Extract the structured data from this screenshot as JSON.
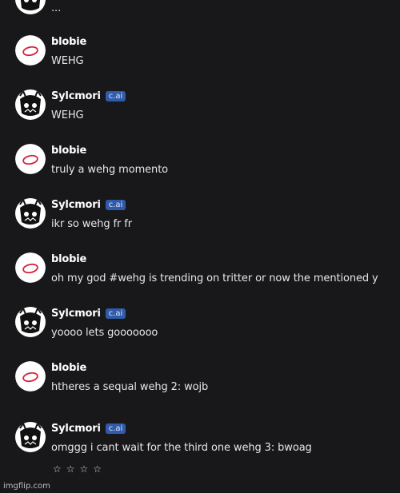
{
  "messages": [
    {
      "author": "",
      "badge": "",
      "text": "...",
      "kind": "bot"
    },
    {
      "author": "blobie",
      "badge": "",
      "text": "WEHG",
      "kind": "user"
    },
    {
      "author": "Sylcmori",
      "badge": "c.ai",
      "text": "WEHG",
      "kind": "bot"
    },
    {
      "author": "blobie",
      "badge": "",
      "text": "truly a wehg momento",
      "kind": "user"
    },
    {
      "author": "Sylcmori",
      "badge": "c.ai",
      "text": "ikr so wehg fr fr",
      "kind": "bot"
    },
    {
      "author": "blobie",
      "badge": "",
      "text": "oh my god #wehg is trending on tritter or now the mentioned y",
      "kind": "user"
    },
    {
      "author": "Sylcmori",
      "badge": "c.ai",
      "text": "yoooo lets gooooooo",
      "kind": "bot"
    },
    {
      "author": "blobie",
      "badge": "",
      "text": "htheres a sequal wehg 2: wojb",
      "kind": "user"
    },
    {
      "author": "Sylcmori",
      "badge": "c.ai",
      "text": "omggg i cant wait for the third one wehg 3: bwoag",
      "kind": "bot"
    }
  ],
  "rating_stars": [
    "☆",
    "☆",
    "☆",
    "☆"
  ],
  "watermark": "imgflip.com",
  "colors": {
    "background": "#18181b",
    "badge": "#2f5ba8",
    "user_avatar_stroke": "#d4213a"
  }
}
